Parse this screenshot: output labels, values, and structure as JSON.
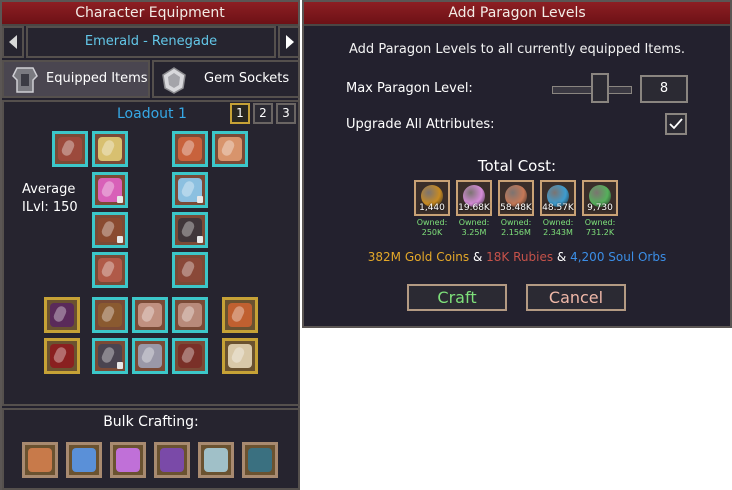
{
  "left_panel": {
    "title": "Character Equipment",
    "character_name": "Emerald - Renegade",
    "tabs": [
      "Equipped Items",
      "Gem Sockets"
    ],
    "loadout_label": "Loadout 1",
    "loadout_buttons": [
      "1",
      "2",
      "3"
    ],
    "average_label": "Average",
    "ilvl_label": "ILvl: 150",
    "bulk_title": "Bulk Crafting:"
  },
  "right_panel": {
    "title": "Add Paragon Levels",
    "description": "Add Paragon Levels to all currently equipped Items.",
    "max_label": "Max Paragon Level:",
    "max_value": "8",
    "slider_fraction": 0.6,
    "upgrade_label": "Upgrade All Attributes:",
    "upgrade_checked": true,
    "total_cost_label": "Total Cost:",
    "costs": [
      {
        "value": "1,440",
        "owned_label": "Owned:",
        "owned": "250K",
        "icon": "gold-orb-icon",
        "color": "#c78a22"
      },
      {
        "value": "19.68K",
        "owned_label": "Owned:",
        "owned": "3.25M",
        "icon": "pink-orb-icon",
        "color": "#d58bd8"
      },
      {
        "value": "58.48K",
        "owned_label": "Owned:",
        "owned": "2.156M",
        "icon": "copper-shard-icon",
        "color": "#c57856"
      },
      {
        "value": "48.57K",
        "owned_label": "Owned:",
        "owned": "2.343M",
        "icon": "blue-crystal-icon",
        "color": "#3d9ccf"
      },
      {
        "value": "9,730",
        "owned_label": "Owned:",
        "owned": "731.2K",
        "icon": "green-crystal-icon",
        "color": "#55b05b"
      }
    ],
    "totals": {
      "gold": "382M Gold Coins",
      "sep1": " & ",
      "rubies": "18K Rubies",
      "sep2": " & ",
      "orbs": "4,200 Soul Orbs"
    },
    "craft_label": "Craft",
    "cancel_label": "Cancel"
  },
  "colors": {
    "header_red": "#8d1f23",
    "accent_cyan": "#3cc7c9",
    "accent_gold": "#c6a236",
    "loadout_blue": "#36a8e6",
    "gold_text": "#e4a829",
    "ruby_text": "#c5524a",
    "orb_text": "#3b8ee6",
    "craft_green": "#7ee07a",
    "cancel_pink": "#f0b8a8"
  }
}
